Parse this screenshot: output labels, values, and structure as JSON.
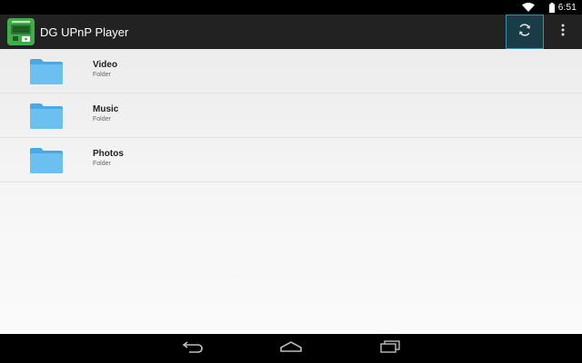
{
  "status_bar": {
    "time": "6:51",
    "wifi_icon": "wifi-icon",
    "battery_icon": "battery-icon"
  },
  "action_bar": {
    "title": "DG UPnP Player",
    "app_icon": "app-logo-icon",
    "refresh_icon": "refresh-icon",
    "overflow_icon": "overflow-menu-icon"
  },
  "folders": [
    {
      "title": "Video",
      "subtitle": "Folder",
      "icon": "folder-icon"
    },
    {
      "title": "Music",
      "subtitle": "Folder",
      "icon": "folder-icon"
    },
    {
      "title": "Photos",
      "subtitle": "Folder",
      "icon": "folder-icon"
    }
  ],
  "nav_bar": {
    "back_icon": "back-icon",
    "home_icon": "home-icon",
    "recents_icon": "recents-icon"
  },
  "colors": {
    "action_bar": "#222222",
    "refresh_highlight": "#3b8fa6",
    "folder": "#5fb8ea",
    "app_icon": "#3fae49"
  }
}
